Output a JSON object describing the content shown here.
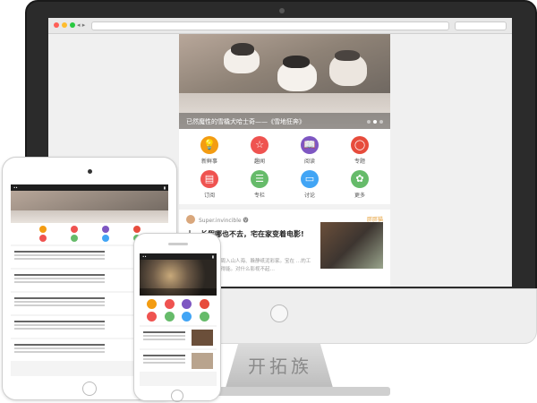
{
  "brand": {
    "stand_text": "开拓族"
  },
  "colors": {
    "accent": "#f39c12",
    "red": "#ef5350",
    "purple": "#7e57c2",
    "blue": "#42a5f5",
    "green": "#66bb6a",
    "dot_close": "#ff5f57",
    "dot_min": "#ffbd2e",
    "dot_max": "#28c940"
  },
  "browser": {
    "nav": "◂ ▸"
  },
  "desktop": {
    "banner_caption": "已然魔性的雪橇犬哈士奇——《雪地狂奔》",
    "icons": [
      {
        "label": "新鲜事",
        "icon": "lightbulb-icon",
        "glyph": "💡",
        "color": "#f39c12"
      },
      {
        "label": "趣闻",
        "icon": "star-icon",
        "glyph": "☆",
        "color": "#ef5350"
      },
      {
        "label": "阅读",
        "icon": "book-icon",
        "glyph": "📖",
        "color": "#7e57c2"
      },
      {
        "label": "专题",
        "icon": "chat-bubble-icon",
        "glyph": "◯",
        "color": "#e74c3c"
      },
      {
        "label": "订阅",
        "icon": "document-icon",
        "glyph": "▤",
        "color": "#ef5350"
      },
      {
        "label": "专栏",
        "icon": "list-icon",
        "glyph": "☰",
        "color": "#66bb6a"
      },
      {
        "label": "讨论",
        "icon": "message-icon",
        "glyph": "▭",
        "color": "#42a5f5"
      },
      {
        "label": "更多",
        "icon": "clover-icon",
        "glyph": "✿",
        "color": "#66bb6a"
      }
    ],
    "article": {
      "author": "Super.invincible 🅥",
      "tag": "胖胖猫",
      "title": "十一长假哪也不去，宅在家变着电影!",
      "excerpt": "云一群人选择去周入山人海、躲静纸泥彩家。宝在 …的工作学习过的您觉得能。对什么影视不起…"
    }
  }
}
